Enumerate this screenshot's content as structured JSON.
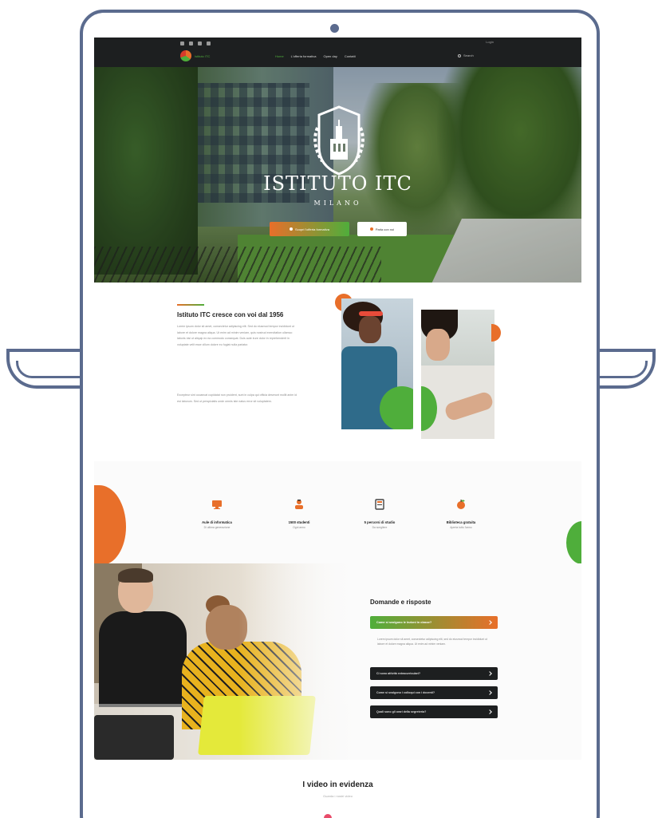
{
  "topbar": {
    "login": "Login",
    "logo_text": "Istituto ITC",
    "nav": [
      "Home",
      "L'offerta formativa",
      "Open day",
      "Contatti"
    ],
    "search": "Search"
  },
  "hero": {
    "title": "ISTITUTO ITC",
    "subtitle": "MILANO",
    "primary_button": "Scopri l'offerta formativa",
    "secondary_button": "Parla con noi"
  },
  "about": {
    "title": "Istituto ITC cresce con voi dal 1956",
    "paragraph1": "Lorem ipsum dolor sit amet, consectetur adipiscing elit. Sed do eiusmod tempor incididunt ut labore et dolore magna aliqua. Ut enim ad minim veniam, quis nostrud exercitation ullamco laboris nisi ut aliquip ex ea commodo consequat. Duis aute irure dolor in reprehenderit in voluptate velit esse cillum dolore eu fugiat nulla pariatur.",
    "paragraph2": "Excepteur sint occaecat cupidatat non proident, sunt in culpa qui officia deserunt mollit anim id est laborum. Sed ut perspiciatis unde omnis iste natus error sit voluptatem."
  },
  "features": [
    {
      "title": "Aule di informatica",
      "sub": "Di ultima generazione",
      "icon": "monitor-icon"
    },
    {
      "title": "1500 studenti",
      "sub": "Ogni anno",
      "icon": "student-icon"
    },
    {
      "title": "5 percorsi di studio",
      "sub": "Da scegliere",
      "icon": "book-icon"
    },
    {
      "title": "Biblioteca gratuita",
      "sub": "Aperta tutto l'anno",
      "icon": "apple-icon"
    }
  ],
  "faq": {
    "title": "Domande e risposte",
    "open_question": "Come si svolgono le lezioni in classe?",
    "open_answer": "Lorem ipsum dolor sit amet, consectetur adipiscing elit, sed do eiusmod tempor incididunt ut labore et dolore magna aliqua. Ut enim ad minim veniam.",
    "questions": [
      "Ci sono attività extracurriculari?",
      "Come si svolgono i colloqui con i docenti?",
      "Quali sono gli orari della segreteria?"
    ]
  },
  "videos": {
    "title": "I video in evidenza",
    "subtitle": "Guarda i nostri video"
  },
  "colors": {
    "orange": "#e86f2a",
    "green": "#4fae3b",
    "dark": "#1d1f20",
    "frame": "#5b6b8e"
  }
}
